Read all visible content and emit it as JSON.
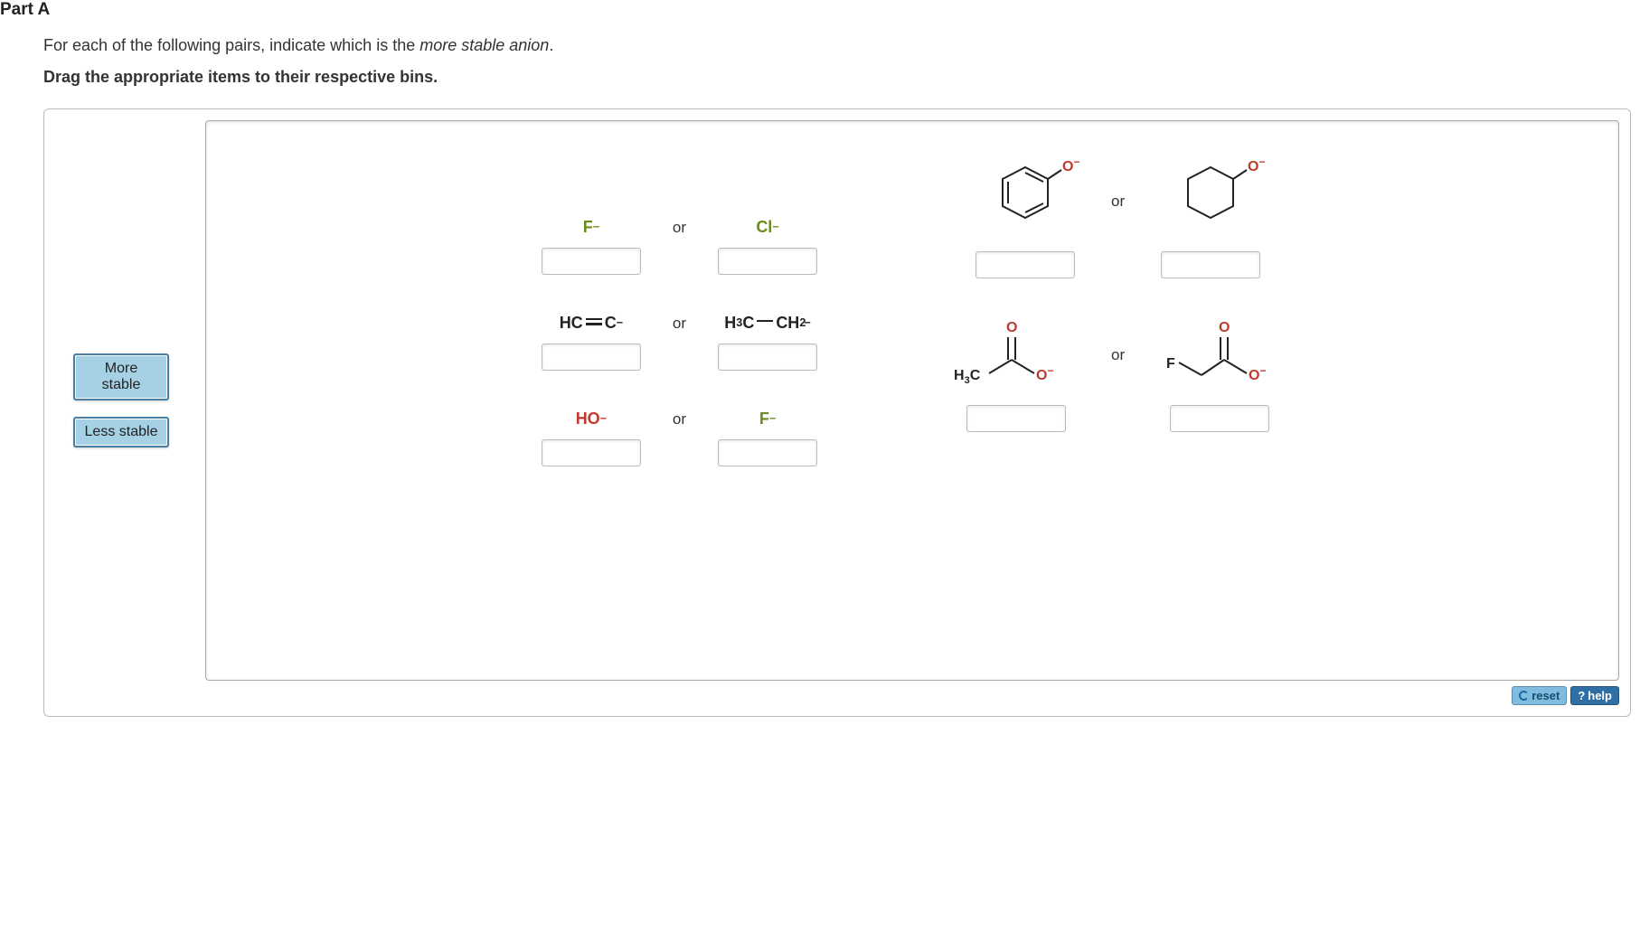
{
  "header": {
    "part": "Part A"
  },
  "question": {
    "text_before": "For each of the following pairs, indicate which is the ",
    "text_em": "more stable anion",
    "text_after": "."
  },
  "instruction": "Drag the appropriate items to their respective bins.",
  "bins": {
    "more": "More stable",
    "less": "Less stable"
  },
  "pairs": {
    "left": [
      {
        "a": {
          "label_html": "F<sup>−</sup>",
          "color": "green"
        },
        "b": {
          "label_html": "Cl<sup>−</sup>",
          "color": "green"
        },
        "or": "or"
      },
      {
        "a": {
          "label_html": "HC  C<sup>−</sup>",
          "color": "black",
          "triple": true
        },
        "b": {
          "label_html": "H<sub>3</sub>C  CH<sub>2</sub><sup>−</sup>",
          "color": "black",
          "single": true
        },
        "or": "or"
      },
      {
        "a": {
          "label_html": "HO<sup>−</sup>",
          "color": "red"
        },
        "b": {
          "label_html": "F<sup>−</sup>",
          "color": "green"
        },
        "or": "or"
      }
    ],
    "right": [
      {
        "a": {
          "structure": "phenoxide"
        },
        "b": {
          "structure": "cyclohexoxide"
        },
        "or": "or"
      },
      {
        "a": {
          "structure": "acetate",
          "label": "H3C"
        },
        "b": {
          "structure": "fluoroacetate",
          "label": "F"
        },
        "or": "or"
      }
    ]
  },
  "footer": {
    "reset": "reset",
    "help": "help"
  },
  "colors": {
    "green": "#6a8c1f",
    "red": "#c0392b"
  }
}
